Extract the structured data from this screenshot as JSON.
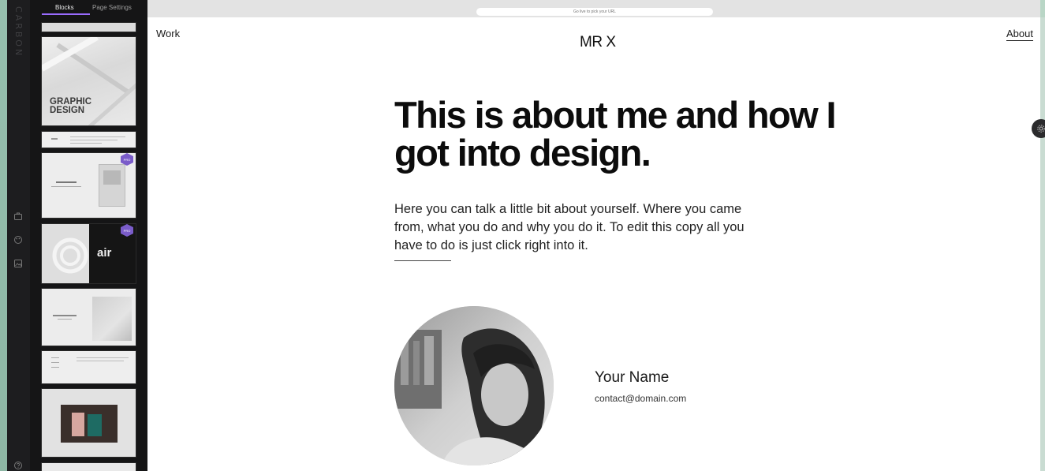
{
  "rail": {
    "brand": "CARBON"
  },
  "panel": {
    "tabs": [
      {
        "label": "Blocks"
      },
      {
        "label": "Page Settings"
      }
    ],
    "thumb_graphic_design": "GRAPHIC DESIGN",
    "thumb_air_logo": "air",
    "pro_badge": "PRO"
  },
  "browser": {
    "url_hint": "Go live to pick your URL"
  },
  "site": {
    "nav_left": "Work",
    "title": "MR X",
    "nav_right": "About",
    "headline": "This is about me and how I got into design.",
    "intro": "Here you can talk a little bit about yourself. Where you came from, what you do and why you do it. To edit this copy all you have to do is just click right into it.",
    "name": "Your Name",
    "email": "contact@domain.com"
  },
  "colors": {
    "accent": "#9a6cff",
    "pro_badge": "#7a5cc9",
    "panel_bg": "#151516",
    "page_bg": "#ffffff"
  }
}
